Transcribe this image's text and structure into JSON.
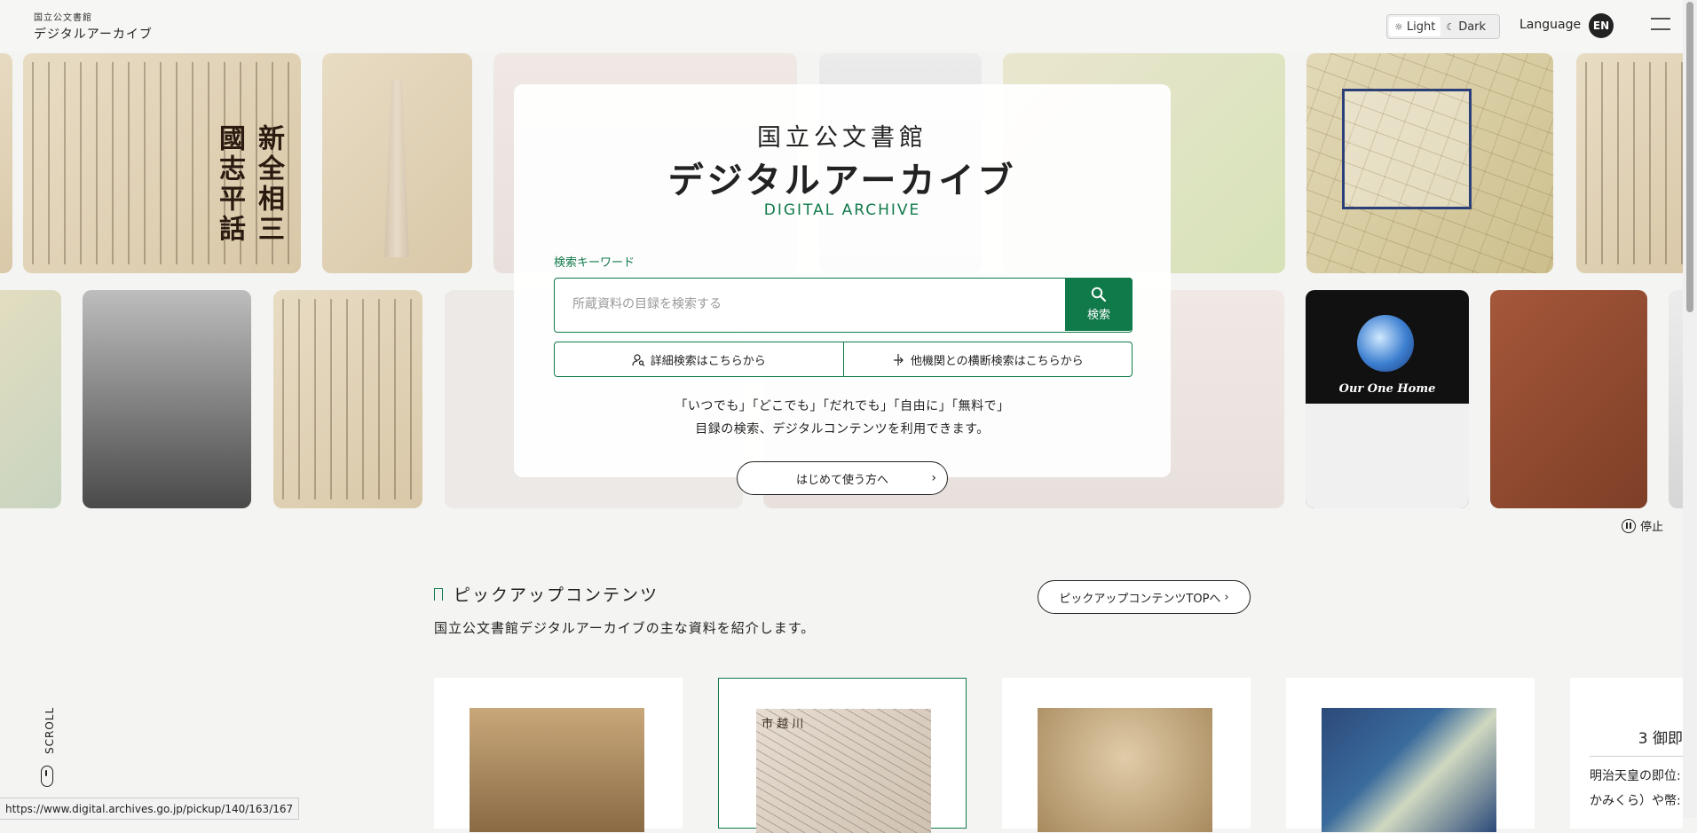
{
  "header": {
    "logo_small": "国立公文書館",
    "logo_big": "デジタルアーカイブ",
    "theme_light": "Light",
    "theme_dark": "Dark",
    "language_label": "Language",
    "language_code": "EN"
  },
  "hero": {
    "title_line1": "国立公文書館",
    "title_line2": "デジタルアーカイブ",
    "subtitle": "DIGITAL ARCHIVE",
    "search_label": "検索キーワード",
    "search_placeholder": "所蔵資料の目録を検索する",
    "search_button": "検索",
    "advanced_search": "詳細検索はこちらから",
    "cross_search": "他機関との横断検索はこちらから",
    "desc_line1": "「いつでも」「どこでも」「だれでも」「自由に」「無料で」",
    "desc_line2": "目録の検索、デジタルコンテンツを利用できます。",
    "beginner_button": "はじめて使う方へ",
    "pause_label": "停止",
    "gallery_text": {
      "tile_book_title": "新全相三國志平話",
      "tile_globe_caption": "Our One Home"
    }
  },
  "pickup": {
    "title": "ピックアップコンテンツ",
    "description": "国立公文書館デジタルアーカイブの主な資料を紹介します。",
    "top_button": "ピックアップコンテンツTOPへ",
    "cards": [
      {
        "name": "card-1"
      },
      {
        "name": "card-2",
        "label": "市 越 川"
      },
      {
        "name": "card-3"
      },
      {
        "name": "card-4"
      },
      {
        "name": "card-5",
        "number": "3 御即",
        "line1": "明治天皇の即位:",
        "line2": "かみくら）や幣:"
      }
    ]
  },
  "scroll_label": "SCROLL",
  "status_url": "https://www.digital.archives.go.jp/pickup/140/163/167",
  "colors": {
    "accent": "#117a4a",
    "background": "#f4f4f2"
  }
}
